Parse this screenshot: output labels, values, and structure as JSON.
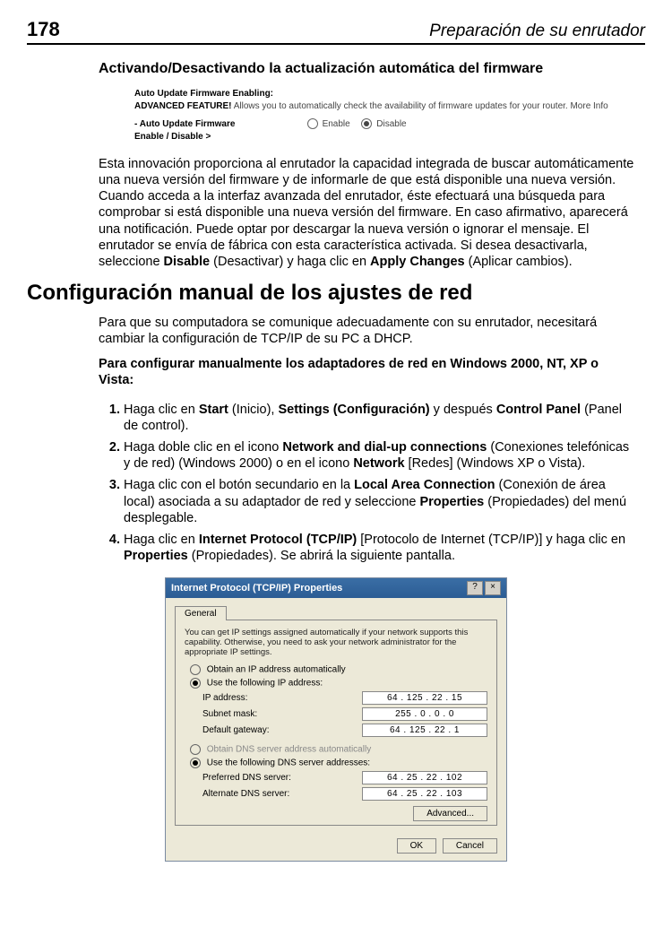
{
  "header": {
    "page_number": "178",
    "title": "Preparación de su enrutador"
  },
  "section1": {
    "title": "Activando/Desactivando la actualización automática del firmware",
    "screenshot": {
      "line1_bold": "Auto Update Firmware Enabling:",
      "line2_bold": "ADVANCED FEATURE!",
      "line2_rest": " Allows you to automatically check the availability of firmware updates for your router. More Info",
      "toggle_label_line1": "- Auto Update Firmware",
      "toggle_label_line2": "Enable / Disable >",
      "opt_enable": "Enable",
      "opt_disable": "Disable"
    },
    "para": "Esta innovación proporciona al enrutador la capacidad integrada de buscar automáticamente una nueva versión del firmware y de informarle de que está disponible una nueva versión. Cuando acceda a la interfaz avanzada del enrutador, éste efectuará una búsqueda para comprobar si está disponible una nueva versión del firmware. En caso afirmativo, aparecerá una notificación. Puede optar por descargar la nueva versión o ignorar el mensaje. El enrutador se envía de fábrica con esta característica activada. Si desea desactivarla, seleccione ",
    "para_bold1": "Disable",
    "para_mid1": " (Desactivar) y haga clic en ",
    "para_bold2": "Apply Changes",
    "para_end": " (Aplicar cambios)."
  },
  "heading2": "Configuración manual de los ajustes de red",
  "para2": "Para que su computadora se comunique adecuadamente con su enrutador, necesitará cambiar la configuración de TCP/IP de su PC a DHCP.",
  "steps_intro": "Para configurar manualmente los adaptadores de red en Windows 2000, NT, XP o Vista:",
  "steps": [
    {
      "pre": "Haga clic en ",
      "b1": "Start",
      "m1": " (Inicio), ",
      "b2": "Settings (Configuración)",
      "m2": " y después ",
      "b3": "Control Panel",
      "post": " (Panel de control)."
    },
    {
      "pre": "Haga doble clic en el icono ",
      "b1": "Network and dial-up connections",
      "m1": " (Conexiones telefónicas y de red) (Windows 2000) o en el icono ",
      "b2": "Network",
      "m2": " [Redes] (Windows XP o Vista).",
      "b3": "",
      "post": ""
    },
    {
      "pre": "Haga clic con el botón secundario en la ",
      "b1": "Local Area Connection",
      "m1": " (Conexión de área local) asociada a su adaptador de red y seleccione ",
      "b2": "Properties",
      "m2": " (Propiedades) del menú desplegable.",
      "b3": "",
      "post": ""
    },
    {
      "pre": "Haga clic en ",
      "b1": "Internet Protocol (TCP/IP)",
      "m1": " [Protocolo de Internet (TCP/IP)] y haga clic en ",
      "b2": "Properties",
      "m2": " (Propiedades). Se abrirá la siguiente pantalla.",
      "b3": "",
      "post": ""
    }
  ],
  "dialog": {
    "title": "Internet Protocol (TCP/IP) Properties",
    "help_btn": "?",
    "close_btn": "×",
    "tab": "General",
    "desc": "You can get IP settings assigned automatically if your network supports this capability. Otherwise, you need to ask your network administrator for the appropriate IP settings.",
    "opt_auto_ip": "Obtain an IP address automatically",
    "opt_use_ip": "Use the following IP address:",
    "ip_label": "IP address:",
    "ip_value": "64 . 125 . 22 . 15",
    "subnet_label": "Subnet mask:",
    "subnet_value": "255 . 0 . 0 . 0",
    "gateway_label": "Default gateway:",
    "gateway_value": "64 . 125 . 22 . 1",
    "opt_auto_dns": "Obtain DNS server address automatically",
    "opt_use_dns": "Use the following DNS server addresses:",
    "pref_dns_label": "Preferred DNS server:",
    "pref_dns_value": "64 . 25 . 22 . 102",
    "alt_dns_label": "Alternate DNS server:",
    "alt_dns_value": "64 . 25 . 22 . 103",
    "advanced_btn": "Advanced...",
    "ok_btn": "OK",
    "cancel_btn": "Cancel"
  }
}
